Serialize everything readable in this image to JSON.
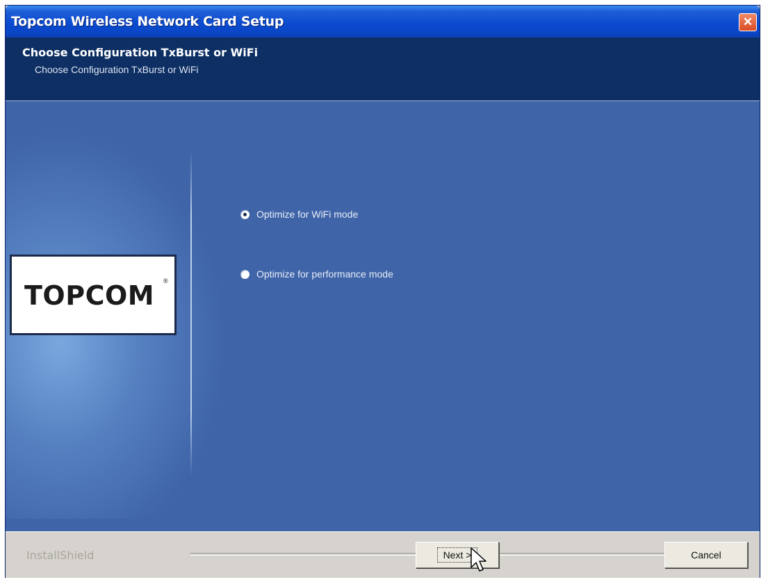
{
  "window": {
    "title": "Topcom Wireless Network Card Setup",
    "close_symbol": "✕"
  },
  "header": {
    "title": "Choose Configuration TxBurst or WiFi",
    "subtitle": "Choose Configuration TxBurst or WiFi"
  },
  "logo": {
    "text": "TOPCOM",
    "reg_mark": "®"
  },
  "options": [
    {
      "label": "Optimize for WiFi mode",
      "selected": true
    },
    {
      "label": "Optimize for performance mode",
      "selected": false
    }
  ],
  "footer": {
    "brand": "InstallShield",
    "next_label": "Next >",
    "cancel_label": "Cancel"
  },
  "colors": {
    "titlebar": "#0b4bd0",
    "header": "#0d2f63",
    "content": "#3f64a8"
  }
}
